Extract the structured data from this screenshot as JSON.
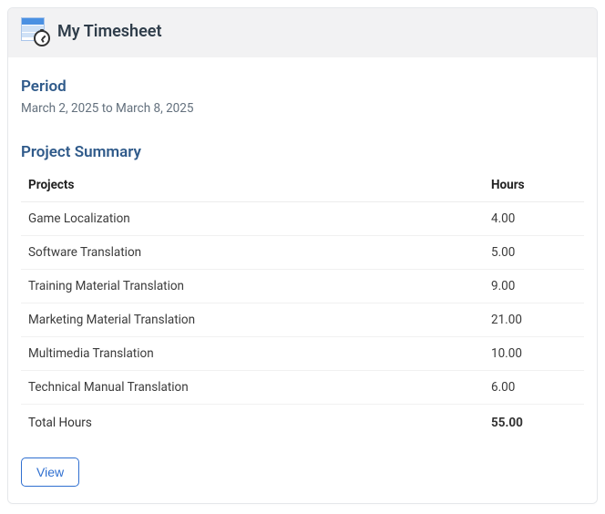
{
  "header": {
    "title": "My Timesheet"
  },
  "period": {
    "label": "Period",
    "range_text": "March 2, 2025 to March 8, 2025"
  },
  "summary": {
    "label": "Project Summary",
    "columns": {
      "projects": "Projects",
      "hours": "Hours"
    },
    "rows": [
      {
        "project": "Game Localization",
        "hours": "4.00"
      },
      {
        "project": "Software Translation",
        "hours": "5.00"
      },
      {
        "project": "Training Material Translation",
        "hours": "9.00"
      },
      {
        "project": "Marketing Material Translation",
        "hours": "21.00"
      },
      {
        "project": "Multimedia Translation",
        "hours": "10.00"
      },
      {
        "project": "Technical Manual Translation",
        "hours": "6.00"
      }
    ],
    "total": {
      "label": "Total Hours",
      "hours": "55.00"
    }
  },
  "actions": {
    "view_label": "View"
  }
}
